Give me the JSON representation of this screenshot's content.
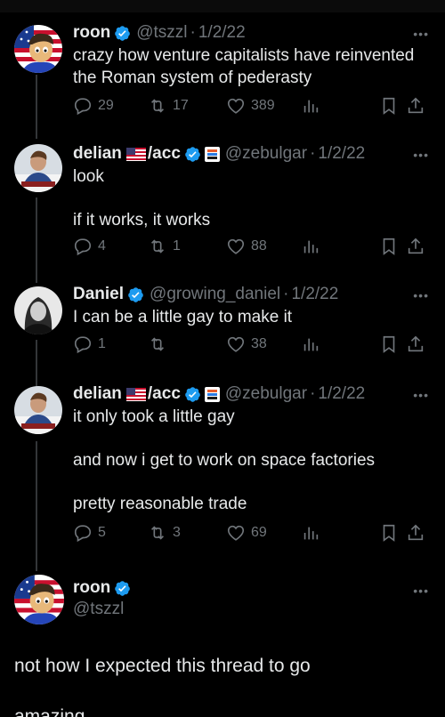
{
  "tweets": [
    {
      "name": "roon",
      "handle": "@tszzl",
      "date": "1/2/22",
      "lines": [
        "crazy how venture capitalists have reinvented",
        "the Roman system of pederasty"
      ],
      "replies": "29",
      "retweets": "17",
      "likes": "389",
      "avatar": "cartoon-flag-avatar"
    },
    {
      "name": "delian",
      "acc": "/acc",
      "handle": "@zebulgar",
      "date": "1/2/22",
      "lines": [
        "look",
        "",
        "if it works, it works"
      ],
      "replies": "4",
      "retweets": "1",
      "likes": "88",
      "avatar": "photo-avatar"
    },
    {
      "name": "Daniel",
      "handle": "@growing_daniel",
      "date": "1/2/22",
      "lines": [
        "I can be a little gay to make it"
      ],
      "replies": "1",
      "retweets": "",
      "likes": "38",
      "avatar": "grayscale-photo-avatar"
    },
    {
      "name": "delian",
      "acc": "/acc",
      "handle": "@zebulgar",
      "date": "1/2/22",
      "lines": [
        "it only took a little gay",
        "",
        "and now i get to work on space factories",
        "",
        "pretty reasonable trade"
      ],
      "replies": "5",
      "retweets": "3",
      "likes": "69",
      "avatar": "photo-avatar"
    }
  ],
  "main_tweet": {
    "name": "roon",
    "handle": "@tszzl",
    "text": "not how I expected this thread to go",
    "text_cut": "amazing"
  },
  "colors": {
    "background": "#000000",
    "text": "#e7e9ea",
    "muted": "#71767b",
    "verified": "#1d9bf0",
    "thread_line": "#333639"
  }
}
